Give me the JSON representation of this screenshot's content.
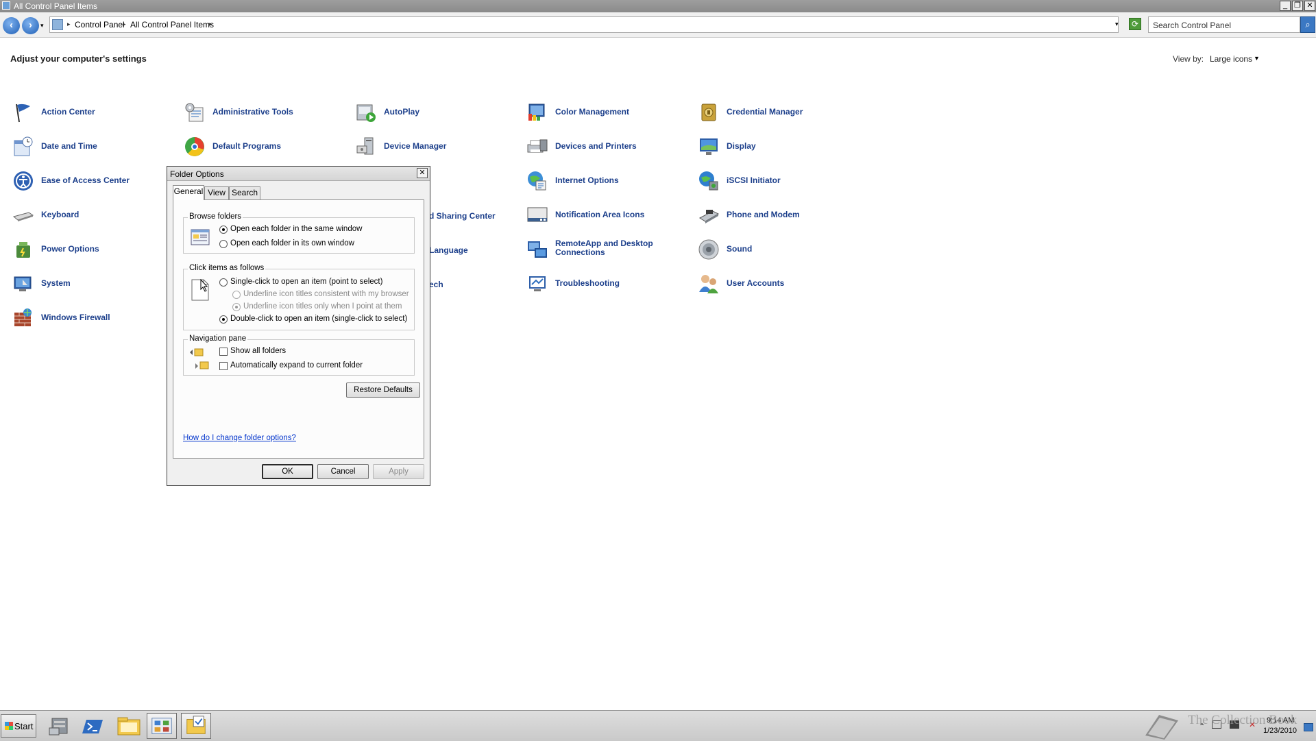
{
  "window": {
    "title": "All Control Panel Items"
  },
  "address": {
    "crumbs": [
      "Control Panel",
      "All Control Panel Items"
    ],
    "search_placeholder": "Search Control Panel"
  },
  "page": {
    "heading": "Adjust your computer's settings",
    "view_by_label": "View by:",
    "view_by_value": "Large icons"
  },
  "items": {
    "action_center": "Action Center",
    "admin_tools": "Administrative Tools",
    "autoplay": "AutoPlay",
    "color_mgmt": "Color Management",
    "credential_mgr": "Credential Manager",
    "date_time": "Date and Time",
    "default_programs": "Default Programs",
    "device_mgr": "Device Manager",
    "devices_printers": "Devices and Printers",
    "display": "Display",
    "ease_access": "Ease of Access Center",
    "internet_options": "Internet Options",
    "iscsi": "iSCSI Initiator",
    "keyboard": "Keyboard",
    "network_sharing_partial": "d Sharing Center",
    "notification_icons": "Notification Area Icons",
    "phone_modem": "Phone and Modem",
    "power_options": "Power Options",
    "language_partial": "Language",
    "remoteapp_line1": "RemoteApp and Desktop",
    "remoteapp_line2": "Connections",
    "sound": "Sound",
    "system": "System",
    "speech_partial": "ech",
    "troubleshooting": "Troubleshooting",
    "user_accounts": "User Accounts",
    "windows_firewall": "Windows Firewall"
  },
  "dialog": {
    "title": "Folder Options",
    "tabs": [
      "General",
      "View",
      "Search"
    ],
    "browse": {
      "title": "Browse folders",
      "opt1": "Open each folder in the same window",
      "opt2": "Open each folder in its own window"
    },
    "click": {
      "title": "Click items as follows",
      "single": "Single-click to open an item (point to select)",
      "underline_browser": "Underline icon titles consistent with my browser",
      "underline_point": "Underline icon titles only when I point at them",
      "double": "Double-click to open an item (single-click to select)"
    },
    "nav": {
      "title": "Navigation pane",
      "show_all": "Show all folders",
      "auto_expand": "Automatically expand to current folder"
    },
    "restore_defaults": "Restore Defaults",
    "help_link": "How do I change folder options?",
    "ok": "OK",
    "cancel": "Cancel",
    "apply": "Apply"
  },
  "taskbar": {
    "start": "Start",
    "time": "9:14 AM",
    "date": "1/23/2010"
  },
  "watermark": "The Collection Book"
}
